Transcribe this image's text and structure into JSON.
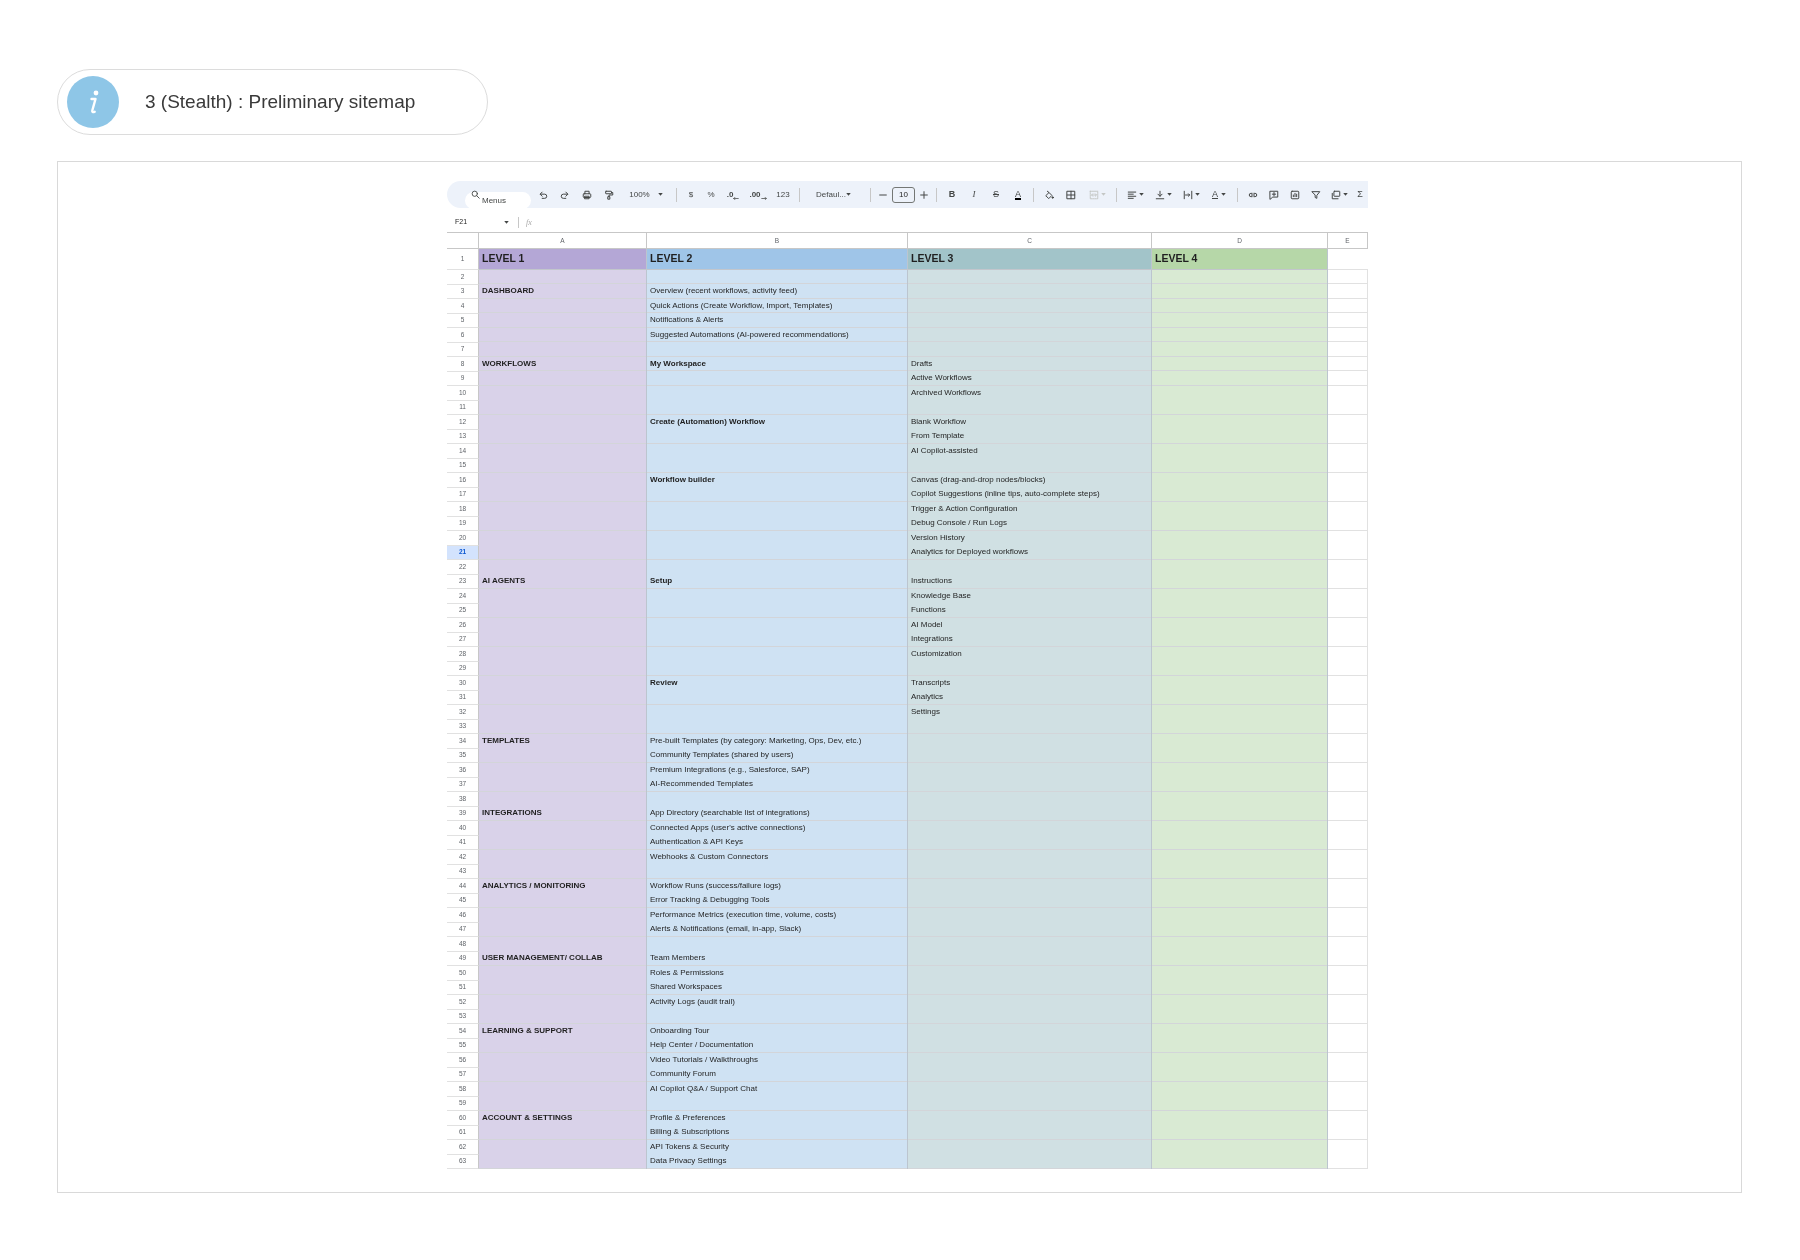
{
  "banner": {
    "title": "3 (Stealth) : Preliminary sitemap"
  },
  "sheet": {
    "toolbar": {
      "search": {
        "placeholder": "Menus"
      },
      "zoom": "100%",
      "currency": "$",
      "percent": "%",
      "decrease_decimal": ".0",
      "increase_decimal": ".00",
      "number_format": "123",
      "font": "Defaul...",
      "font_size": "10",
      "bold_button": "B",
      "italic_button": "I",
      "strikethrough_button": "S",
      "text_color_button": "A",
      "merge_cells": {
        "disabled": true
      },
      "text_rotation_button": "A",
      "sum_button": "Σ"
    },
    "formula_bar": {
      "name_box": "F21",
      "function_label": "fx"
    },
    "columns": [
      {
        "letter": "A",
        "color": "#d9d2e9"
      },
      {
        "letter": "B",
        "color": "#cfe2f3"
      },
      {
        "letter": "C",
        "color": "#d0e0e3"
      },
      {
        "letter": "D",
        "color": "#d9ead3"
      },
      {
        "letter": "E"
      }
    ],
    "rows": [
      {
        "number": "1",
        "kind": "header",
        "selected": false,
        "cells": {
          "a": {
            "text": "LEVEL 1",
            "bold": true,
            "color": "#b4a7d6"
          },
          "b": {
            "text": "LEVEL 2",
            "bold": true,
            "color": "#9fc5e8"
          },
          "c": {
            "text": "LEVEL 3",
            "bold": true,
            "color": "#a2c4c9"
          },
          "d": {
            "text": "LEVEL 4",
            "bold": true,
            "color": "#b6d7a8"
          }
        }
      },
      {
        "number": "2",
        "kind": "data",
        "selected": false
      },
      {
        "number": "3",
        "kind": "data",
        "selected": false,
        "cells": {
          "a": {
            "text": "DASHBOARD",
            "bold": true
          },
          "b": {
            "text": "Overview (recent workflows, activity feed)",
            "bold": false
          }
        }
      },
      {
        "number": "4",
        "kind": "data",
        "selected": false,
        "cells": {
          "b": {
            "text": "Quick Actions (Create Workflow, Import, Templates)",
            "bold": false
          }
        }
      },
      {
        "number": "5",
        "kind": "data",
        "selected": false,
        "cells": {
          "b": {
            "text": "Notifications & Alerts",
            "bold": false
          }
        }
      },
      {
        "number": "6",
        "kind": "data",
        "selected": false,
        "cells": {
          "b": {
            "text": "Suggested Automations (AI-powered recommendations)",
            "bold": false
          }
        }
      },
      {
        "number": "7",
        "kind": "data",
        "selected": false
      },
      {
        "number": "8",
        "kind": "data",
        "selected": false,
        "cells": {
          "a": {
            "text": "WORKFLOWS",
            "bold": true
          },
          "b": {
            "text": "My Workspace",
            "bold": true
          },
          "c": {
            "text": "Drafts",
            "bold": false
          }
        }
      },
      {
        "number": "9",
        "kind": "data",
        "selected": false,
        "cells": {
          "c": {
            "text": "Active Workflows",
            "bold": false
          }
        }
      },
      {
        "number": "10",
        "kind": "data",
        "selected": false,
        "cells": {
          "c": {
            "text": "Archived Workflows",
            "bold": false
          }
        }
      },
      {
        "number": "11",
        "kind": "data",
        "selected": false
      },
      {
        "number": "12",
        "kind": "data",
        "selected": false,
        "cells": {
          "b": {
            "text": "Create (Automation) Workflow",
            "bold": true
          },
          "c": {
            "text": "Blank Workflow",
            "bold": false
          }
        }
      },
      {
        "number": "13",
        "kind": "data",
        "selected": false,
        "cells": {
          "c": {
            "text": "From Template",
            "bold": false
          }
        }
      },
      {
        "number": "14",
        "kind": "data",
        "selected": false,
        "cells": {
          "c": {
            "text": "AI Copilot-assisted",
            "bold": false
          }
        }
      },
      {
        "number": "15",
        "kind": "data",
        "selected": false
      },
      {
        "number": "16",
        "kind": "data",
        "selected": false,
        "cells": {
          "b": {
            "text": "Workflow builder",
            "bold": true
          },
          "c": {
            "text": "Canvas (drag-and-drop nodes/blocks)",
            "bold": false
          }
        }
      },
      {
        "number": "17",
        "kind": "data",
        "selected": false,
        "cells": {
          "c": {
            "text": "Copilot Suggestions (inline tips, auto-complete steps)",
            "bold": false
          }
        }
      },
      {
        "number": "18",
        "kind": "data",
        "selected": false,
        "cells": {
          "c": {
            "text": "Trigger & Action Configuration",
            "bold": false
          }
        }
      },
      {
        "number": "19",
        "kind": "data",
        "selected": false,
        "cells": {
          "c": {
            "text": "Debug Console / Run Logs",
            "bold": false
          }
        }
      },
      {
        "number": "20",
        "kind": "data",
        "selected": false,
        "cells": {
          "c": {
            "text": "Version History",
            "bold": false
          }
        }
      },
      {
        "number": "21",
        "kind": "data",
        "selected": true,
        "cells": {
          "c": {
            "text": "Analytics for Deployed workflows",
            "bold": false
          }
        }
      },
      {
        "number": "22",
        "kind": "data",
        "selected": false
      },
      {
        "number": "23",
        "kind": "data",
        "selected": false,
        "cells": {
          "a": {
            "text": "AI AGENTS",
            "bold": true
          },
          "b": {
            "text": "Setup",
            "bold": true
          },
          "c": {
            "text": "Instructions",
            "bold": false
          }
        }
      },
      {
        "number": "24",
        "kind": "data",
        "selected": false,
        "cells": {
          "c": {
            "text": "Knowledge Base",
            "bold": false
          }
        }
      },
      {
        "number": "25",
        "kind": "data",
        "selected": false,
        "cells": {
          "c": {
            "text": "Functions",
            "bold": false
          }
        }
      },
      {
        "number": "26",
        "kind": "data",
        "selected": false,
        "cells": {
          "c": {
            "text": "AI Model",
            "bold": false
          }
        }
      },
      {
        "number": "27",
        "kind": "data",
        "selected": false,
        "cells": {
          "c": {
            "text": "Integrations",
            "bold": false
          }
        }
      },
      {
        "number": "28",
        "kind": "data",
        "selected": false,
        "cells": {
          "c": {
            "text": "Customization",
            "bold": false
          }
        }
      },
      {
        "number": "29",
        "kind": "data",
        "selected": false
      },
      {
        "number": "30",
        "kind": "data",
        "selected": false,
        "cells": {
          "b": {
            "text": "Review",
            "bold": true
          },
          "c": {
            "text": "Transcripts",
            "bold": false
          }
        }
      },
      {
        "number": "31",
        "kind": "data",
        "selected": false,
        "cells": {
          "c": {
            "text": "Analytics",
            "bold": false
          }
        }
      },
      {
        "number": "32",
        "kind": "data",
        "selected": false,
        "cells": {
          "c": {
            "text": "Settings",
            "bold": false
          }
        }
      },
      {
        "number": "33",
        "kind": "data",
        "selected": false
      },
      {
        "number": "34",
        "kind": "data",
        "selected": false,
        "cells": {
          "a": {
            "text": "TEMPLATES",
            "bold": true
          },
          "b": {
            "text": "Pre-built Templates (by category: Marketing, Ops, Dev, etc.)",
            "bold": false
          }
        }
      },
      {
        "number": "35",
        "kind": "data",
        "selected": false,
        "cells": {
          "b": {
            "text": "Community Templates (shared by users)",
            "bold": false
          }
        }
      },
      {
        "number": "36",
        "kind": "data",
        "selected": false,
        "cells": {
          "b": {
            "text": "Premium Integrations (e.g., Salesforce, SAP)",
            "bold": false
          }
        }
      },
      {
        "number": "37",
        "kind": "data",
        "selected": false,
        "cells": {
          "b": {
            "text": "AI-Recommended Templates",
            "bold": false
          }
        }
      },
      {
        "number": "38",
        "kind": "data",
        "selected": false
      },
      {
        "number": "39",
        "kind": "data",
        "selected": false,
        "cells": {
          "a": {
            "text": "INTEGRATIONS",
            "bold": true
          },
          "b": {
            "text": "App Directory (searchable list of integrations)",
            "bold": false
          }
        }
      },
      {
        "number": "40",
        "kind": "data",
        "selected": false,
        "cells": {
          "b": {
            "text": "Connected Apps (user's active connections)",
            "bold": false
          }
        }
      },
      {
        "number": "41",
        "kind": "data",
        "selected": false,
        "cells": {
          "b": {
            "text": "Authentication & API Keys",
            "bold": false
          }
        }
      },
      {
        "number": "42",
        "kind": "data",
        "selected": false,
        "cells": {
          "b": {
            "text": "Webhooks & Custom Connectors",
            "bold": false
          }
        }
      },
      {
        "number": "43",
        "kind": "data",
        "selected": false
      },
      {
        "number": "44",
        "kind": "data",
        "selected": false,
        "cells": {
          "a": {
            "text": "ANALYTICS / MONITORING",
            "bold": true
          },
          "b": {
            "text": "Workflow Runs (success/failure logs)",
            "bold": false
          }
        }
      },
      {
        "number": "45",
        "kind": "data",
        "selected": false,
        "cells": {
          "b": {
            "text": "Error Tracking & Debugging Tools",
            "bold": false
          }
        }
      },
      {
        "number": "46",
        "kind": "data",
        "selected": false,
        "cells": {
          "b": {
            "text": "Performance Metrics (execution time, volume, costs)",
            "bold": false
          }
        }
      },
      {
        "number": "47",
        "kind": "data",
        "selected": false,
        "cells": {
          "b": {
            "text": "Alerts & Notifications (email, in-app, Slack)",
            "bold": false
          }
        }
      },
      {
        "number": "48",
        "kind": "data",
        "selected": false
      },
      {
        "number": "49",
        "kind": "data",
        "selected": false,
        "cells": {
          "a": {
            "text": "USER MANAGEMENT/ COLLAB",
            "bold": true
          },
          "b": {
            "text": "Team Members",
            "bold": false
          }
        }
      },
      {
        "number": "50",
        "kind": "data",
        "selected": false,
        "cells": {
          "b": {
            "text": "Roles & Permissions",
            "bold": false
          }
        }
      },
      {
        "number": "51",
        "kind": "data",
        "selected": false,
        "cells": {
          "b": {
            "text": "Shared Workspaces",
            "bold": false
          }
        }
      },
      {
        "number": "52",
        "kind": "data",
        "selected": false,
        "cells": {
          "b": {
            "text": "Activity Logs (audit trail)",
            "bold": false
          }
        }
      },
      {
        "number": "53",
        "kind": "data",
        "selected": false
      },
      {
        "number": "54",
        "kind": "data",
        "selected": false,
        "cells": {
          "a": {
            "text": "LEARNING & SUPPORT",
            "bold": true
          },
          "b": {
            "text": "Onboarding Tour",
            "bold": false
          }
        }
      },
      {
        "number": "55",
        "kind": "data",
        "selected": false,
        "cells": {
          "b": {
            "text": "Help Center / Documentation",
            "bold": false
          }
        }
      },
      {
        "number": "56",
        "kind": "data",
        "selected": false,
        "cells": {
          "b": {
            "text": "Video Tutorials / Walkthroughs",
            "bold": false
          }
        }
      },
      {
        "number": "57",
        "kind": "data",
        "selected": false,
        "cells": {
          "b": {
            "text": "Community Forum",
            "bold": false
          }
        }
      },
      {
        "number": "58",
        "kind": "data",
        "selected": false,
        "cells": {
          "b": {
            "text": "AI Copilot Q&A / Support Chat",
            "bold": false
          }
        }
      },
      {
        "number": "59",
        "kind": "data",
        "selected": false
      },
      {
        "number": "60",
        "kind": "data",
        "selected": false,
        "cells": {
          "a": {
            "text": "ACCOUNT & SETTINGS",
            "bold": true
          },
          "b": {
            "text": "Profile & Preferences",
            "bold": false
          }
        }
      },
      {
        "number": "61",
        "kind": "data",
        "selected": false,
        "cells": {
          "b": {
            "text": "Billing & Subscriptions",
            "bold": false
          }
        }
      },
      {
        "number": "62",
        "kind": "data",
        "selected": false,
        "cells": {
          "b": {
            "text": "API Tokens & Security",
            "bold": false
          }
        }
      },
      {
        "number": "63",
        "kind": "data",
        "selected": false,
        "cells": {
          "b": {
            "text": "Data Privacy Settings",
            "bold": false
          }
        }
      }
    ]
  }
}
